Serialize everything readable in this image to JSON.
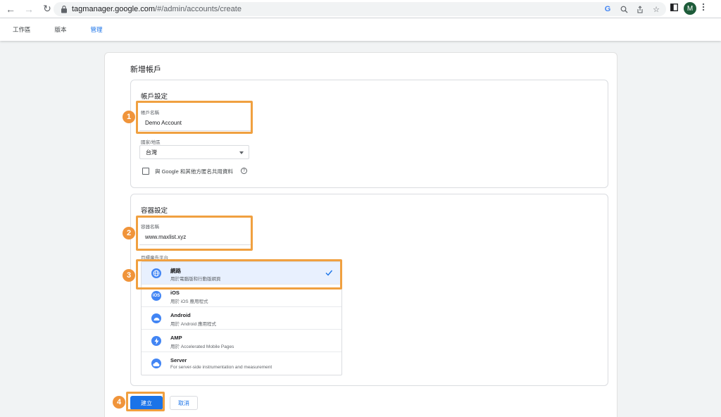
{
  "browser": {
    "url_host": "tagmanager.google.com",
    "url_path": "/#/admin/accounts/create",
    "avatar_letter": "M"
  },
  "appbar": {
    "tabs": [
      {
        "label": "工作區",
        "active": false
      },
      {
        "label": "版本",
        "active": false
      },
      {
        "label": "管理",
        "active": true
      }
    ]
  },
  "page": {
    "title": "新增帳戶"
  },
  "account_settings": {
    "title": "帳戶設定",
    "name_label": "帳戶名稱",
    "name_value": "Demo Account",
    "country_label": "國家/地區",
    "country_value": "台灣",
    "share_label": "與 Google 和其他方匿名共用資料"
  },
  "container_settings": {
    "title": "容器設定",
    "name_label": "容器名稱",
    "name_value": "www.maxlist.xyz",
    "platform_label": "目標廣告平台",
    "platforms": [
      {
        "name": "網路",
        "desc": "用於電腦版和行動版網頁",
        "icon": "globe-icon",
        "selected": true
      },
      {
        "name": "iOS",
        "desc": "用於 iOS 應用程式",
        "icon": "ios-icon",
        "selected": false
      },
      {
        "name": "Android",
        "desc": "用於 Android 應用程式",
        "icon": "android-icon",
        "selected": false
      },
      {
        "name": "AMP",
        "desc": "用於 Accelerated Mobile Pages",
        "icon": "amp-bolt-icon",
        "selected": false
      },
      {
        "name": "Server",
        "desc": "For server-side instrumentation and measurement",
        "icon": "cloud-icon",
        "selected": false
      }
    ]
  },
  "actions": {
    "create_label": "建立",
    "cancel_label": "取消"
  },
  "annotations": {
    "badges": [
      "1",
      "2",
      "3",
      "4"
    ],
    "highlight_color": "#f0a040"
  },
  "colors": {
    "accent": "#1a73e8",
    "selected_bg": "#e8f0fe",
    "platform_icon": "#4285f4"
  }
}
